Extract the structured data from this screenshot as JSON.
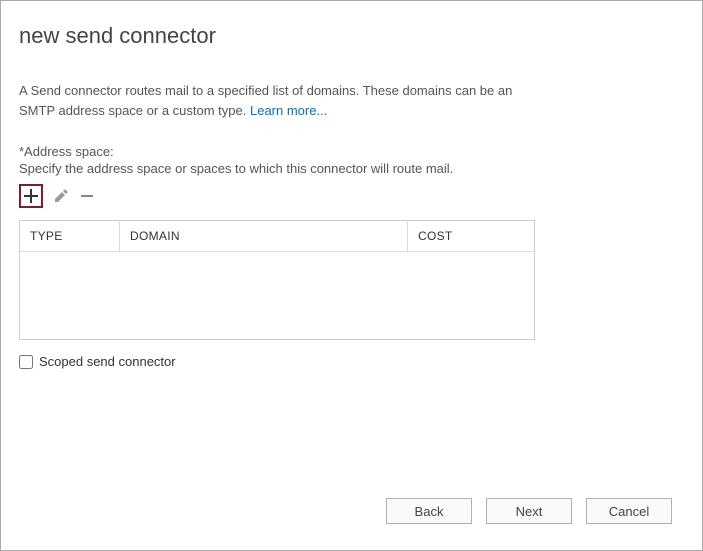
{
  "header": {
    "title": "new send connector"
  },
  "description": {
    "text": "A Send connector routes mail to a specified list of domains. These domains can be an SMTP address space or a custom type. ",
    "link": "Learn more..."
  },
  "section": {
    "label": "*Address space:",
    "sub": "Specify the address space or spaces to which this connector will route mail."
  },
  "table": {
    "headers": {
      "type": "TYPE",
      "domain": "DOMAIN",
      "cost": "COST"
    },
    "rows": []
  },
  "checkbox": {
    "scoped_label": "Scoped send connector",
    "scoped_checked": false
  },
  "buttons": {
    "back": "Back",
    "next": "Next",
    "cancel": "Cancel"
  }
}
